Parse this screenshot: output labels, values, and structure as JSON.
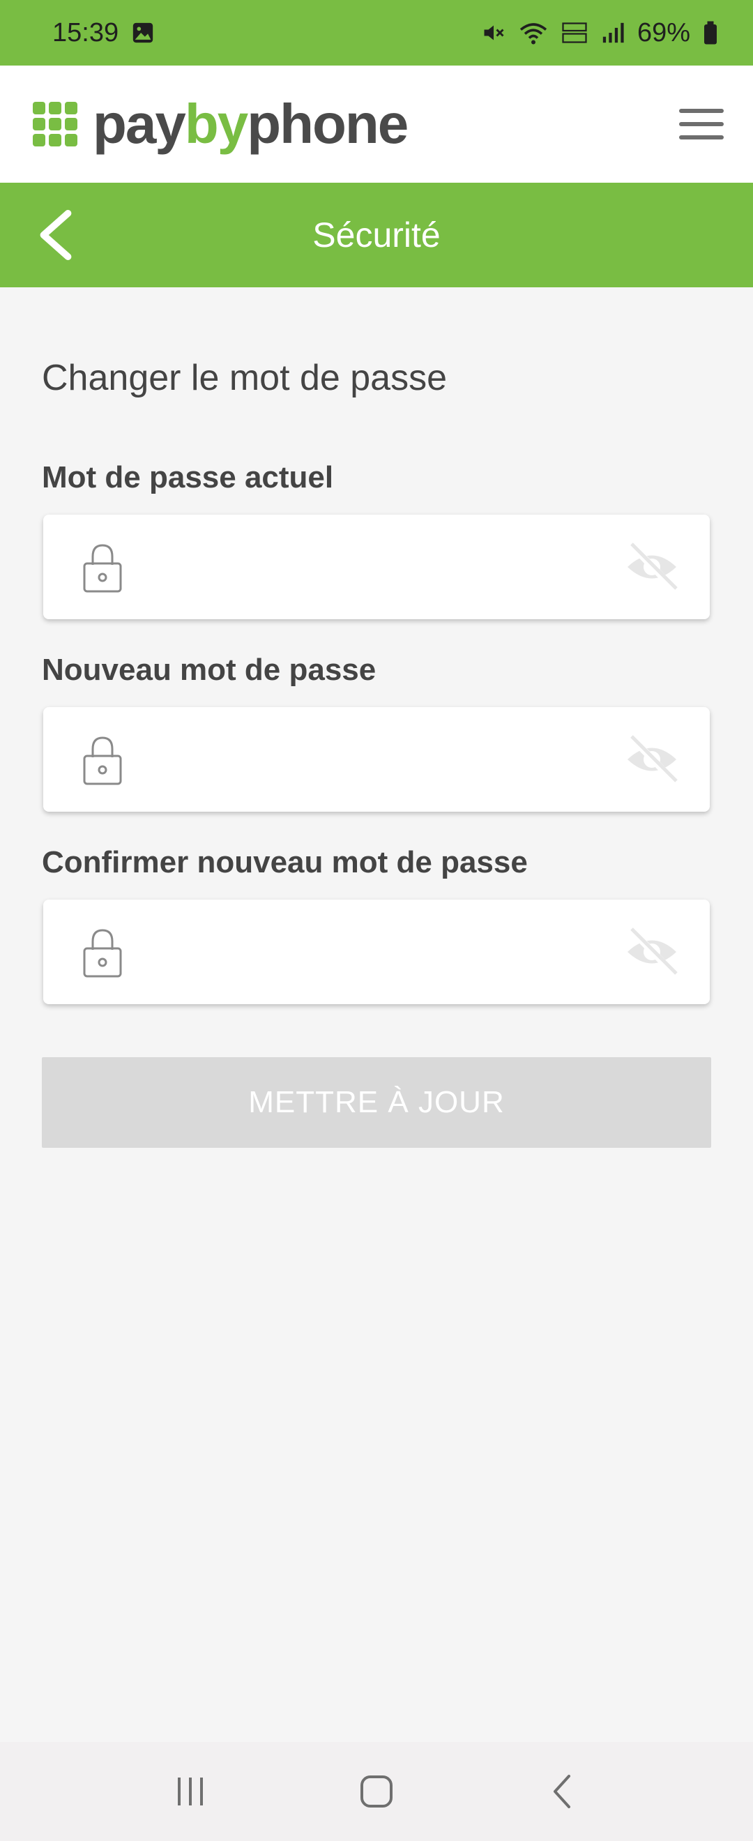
{
  "status_bar": {
    "time": "15:39",
    "battery": "69%",
    "icons": [
      "gallery-icon",
      "mute-icon",
      "wifi-icon",
      "volte-icon",
      "signal-icon",
      "battery-icon"
    ]
  },
  "brand": {
    "logo_pay": "pay",
    "logo_by": "by",
    "logo_phone": "phone",
    "accent_color": "#79bd43"
  },
  "title_bar": {
    "title": "Sécurité"
  },
  "form": {
    "section_title": "Changer le mot de passe",
    "fields": [
      {
        "label": "Mot de passe actuel",
        "value": ""
      },
      {
        "label": "Nouveau mot de passe",
        "value": ""
      },
      {
        "label": "Confirmer nouveau mot de passe",
        "value": ""
      }
    ],
    "submit_label": "METTRE À JOUR"
  },
  "nav": {
    "icons": [
      "recent-apps-icon",
      "home-icon",
      "back-icon"
    ]
  }
}
